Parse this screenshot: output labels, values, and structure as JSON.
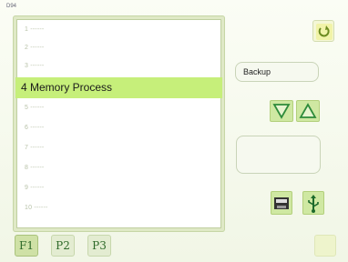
{
  "window": {
    "title_tag": "D94"
  },
  "list": {
    "items": [
      {
        "label": "1 ------"
      },
      {
        "label": "2 ------"
      },
      {
        "label": "3 ------"
      },
      {
        "label": "4 Memory Process",
        "selected": true
      },
      {
        "label": "5 ------"
      },
      {
        "label": "6 ------"
      },
      {
        "label": "7 ------"
      },
      {
        "label": "8 ------"
      },
      {
        "label": "9 ------"
      },
      {
        "label": "10 ------"
      }
    ]
  },
  "tabs": [
    {
      "label": "F1",
      "active": true
    },
    {
      "label": "P2"
    },
    {
      "label": "P3"
    }
  ],
  "side": {
    "backup_label": "Backup",
    "icons": {
      "top": "rotate-arrow-icon",
      "down": "down-triangle-icon",
      "up": "up-triangle-icon",
      "floppy": "floppy-disk-icon",
      "usb": "usb-icon",
      "corner": "blank-icon"
    }
  },
  "colors": {
    "selection": "#c6ef7a",
    "button_green": "#cfe8a2",
    "arrow_green": "#2e8b3a"
  }
}
